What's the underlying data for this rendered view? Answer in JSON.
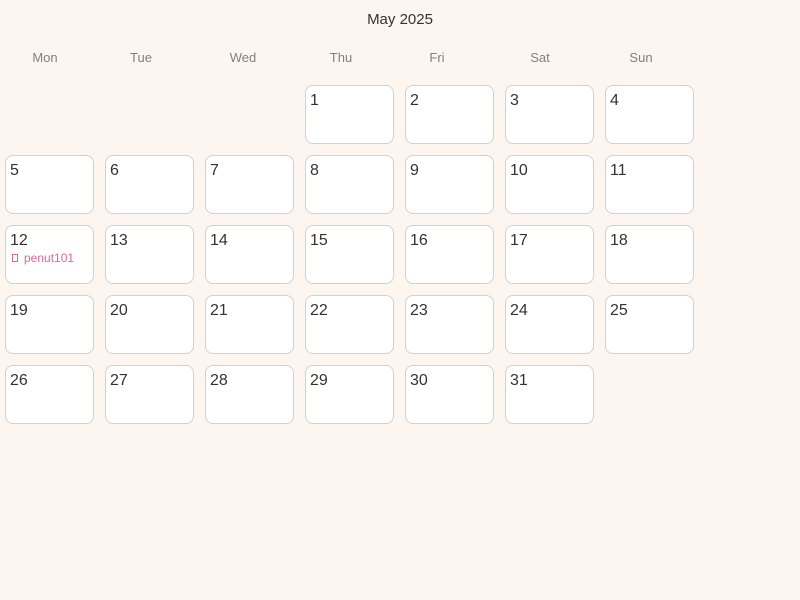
{
  "calendar": {
    "title": "May 2025",
    "weekdays": [
      "Mon",
      "Tue",
      "Wed",
      "Thu",
      "Fri",
      "Sat",
      "Sun"
    ],
    "first_weekday_index": 3,
    "days": [
      {
        "label": "1"
      },
      {
        "label": "2"
      },
      {
        "label": "3"
      },
      {
        "label": "4"
      },
      {
        "label": "5"
      },
      {
        "label": "6"
      },
      {
        "label": "7"
      },
      {
        "label": "8"
      },
      {
        "label": "9"
      },
      {
        "label": "10"
      },
      {
        "label": "11"
      },
      {
        "label": "12",
        "events": [
          {
            "title": "penut101",
            "icon": "event-marker-icon",
            "color": "#d36aa4"
          }
        ]
      },
      {
        "label": "13"
      },
      {
        "label": "14"
      },
      {
        "label": "15"
      },
      {
        "label": "16"
      },
      {
        "label": "17"
      },
      {
        "label": "18"
      },
      {
        "label": "19"
      },
      {
        "label": "20"
      },
      {
        "label": "21"
      },
      {
        "label": "22"
      },
      {
        "label": "23"
      },
      {
        "label": "24"
      },
      {
        "label": "25"
      },
      {
        "label": "26"
      },
      {
        "label": "27"
      },
      {
        "label": "28"
      },
      {
        "label": "29"
      },
      {
        "label": "30"
      },
      {
        "label": "31"
      }
    ]
  },
  "colors": {
    "background": "#fdf6f0",
    "cell_background": "#ffffff",
    "cell_border": "#d6d0cb",
    "event_text": "#d36aa4",
    "weekday_text": "#808080"
  }
}
